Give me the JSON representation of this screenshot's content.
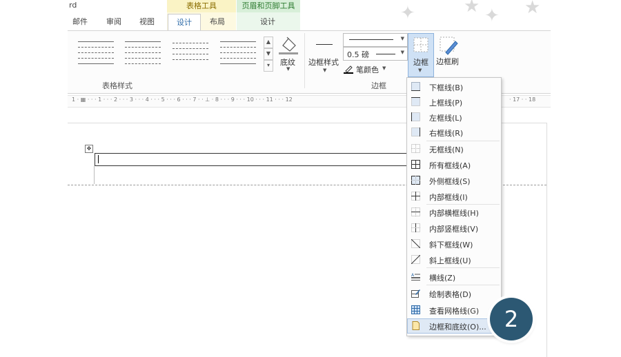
{
  "window": {
    "title_fragment": "rd"
  },
  "context_tabs": {
    "table_tools": "表格工具",
    "header_footer_tools": "页眉和页脚工具"
  },
  "tabs": [
    {
      "label": "邮件"
    },
    {
      "label": "审阅"
    },
    {
      "label": "视图"
    },
    {
      "label": "设计"
    },
    {
      "label": "布局"
    },
    {
      "label": "设计"
    }
  ],
  "active_tab": "设计",
  "ribbon": {
    "group_table_styles": "表格样式",
    "group_borders": "边框",
    "shading_label": "底纹",
    "border_styles_label": "边框样式",
    "line_weight": "0.5 磅",
    "pen_color_label": "笔颜色",
    "borders_button_label": "边框",
    "border_painter_label": "边框刷"
  },
  "ruler": {
    "text": "1 · ▦ · · · 1 · · · 2 · · · 3 · · · 4 · · · 5 · · · 6 · · · 7 · · ⊥ · 8 · · · 9 · · · 10 · · · 11 · · · 12",
    "tail": "· 17 · · 18"
  },
  "menu": {
    "items": [
      {
        "label": "下框线(B)",
        "icon": "bottom-border-icon"
      },
      {
        "label": "上框线(P)",
        "icon": "top-border-icon"
      },
      {
        "label": "左框线(L)",
        "icon": "left-border-icon"
      },
      {
        "label": "右框线(R)",
        "icon": "right-border-icon"
      },
      {
        "label": "无框线(N)",
        "icon": "no-border-icon"
      },
      {
        "label": "所有框线(A)",
        "icon": "all-borders-icon"
      },
      {
        "label": "外侧框线(S)",
        "icon": "outside-borders-icon"
      },
      {
        "label": "内部框线(I)",
        "icon": "inside-borders-icon"
      },
      {
        "label": "内部横框线(H)",
        "icon": "inside-horizontal-border-icon"
      },
      {
        "label": "内部竖框线(V)",
        "icon": "inside-vertical-border-icon"
      },
      {
        "label": "斜下框线(W)",
        "icon": "diagonal-down-border-icon"
      },
      {
        "label": "斜上框线(U)",
        "icon": "diagonal-up-border-icon"
      },
      {
        "label": "横线(Z)",
        "icon": "horizontal-line-icon"
      },
      {
        "label": "绘制表格(D)",
        "icon": "draw-table-icon"
      },
      {
        "label": "查看网格线(G)",
        "icon": "view-gridlines-icon"
      },
      {
        "label": "边框和底纹(O)...",
        "icon": "borders-and-shading-icon"
      }
    ]
  },
  "badge": {
    "number": "2"
  },
  "colors": {
    "accent": "#2d6aa8",
    "badge": "#2c5873",
    "table_tools_bg": "#faf3c5",
    "header_tools_bg": "#d8efd9"
  }
}
